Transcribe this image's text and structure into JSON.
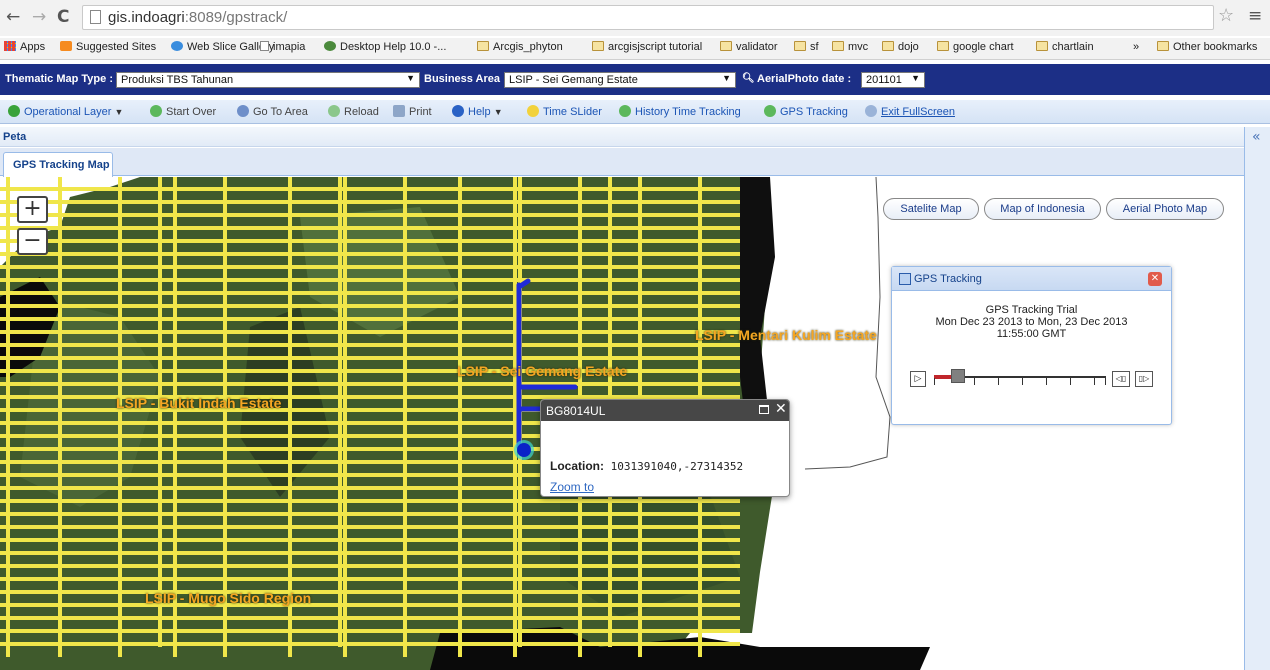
{
  "browser": {
    "url_host": "gis.indoagri",
    "url_rest": ":8089/gpstrack/",
    "bookmarks": [
      "Apps",
      "Suggested Sites",
      "Web Slice Gallery",
      "imapia",
      "Desktop Help 10.0 -...",
      "Arcgis_phyton",
      "arcgisjscript tutorial",
      "validator",
      "sf",
      "mvc",
      "dojo",
      "google chart",
      "chartlain",
      "»",
      "Other bookmarks"
    ]
  },
  "header": {
    "thematic_label": "Thematic Map Type :",
    "thematic_value": "Produksi TBS Tahunan",
    "business_label": "Business Area :",
    "business_value": "LSIP - Sei Gemang Estate",
    "aerial_label": "AerialPhoto date :",
    "aerial_value": "201101"
  },
  "toolbar": {
    "operational_layer": "Operational Layer",
    "start_over": "Start Over",
    "go_to_area": "Go To Area",
    "reload": "Reload",
    "print": "Print",
    "help": "Help",
    "time_slider": "Time SLider",
    "history_tracking": "History Time Tracking",
    "gps_tracking": "GPS Tracking",
    "exit_fullscreen": "Exit FullScreen"
  },
  "panel": {
    "title": "Peta",
    "collapse": "«",
    "tab": "GPS Tracking Map"
  },
  "map": {
    "zoom_in": "+",
    "zoom_out": "−",
    "basemap_buttons": [
      "Satelite Map",
      "Map of Indonesia",
      "Aerial Photo Map"
    ],
    "estate_labels": [
      "LSIP - Mentari Kulim Estate",
      "LSIP - Sei Gemang Estate",
      "LSIP - Bukit Indah Estate",
      "LSIP - Mugo Sido Region"
    ]
  },
  "gps_window": {
    "title": "GPS Tracking",
    "line1": "GPS Tracking Trial",
    "line2": "Mon Dec 23 2013  to  Mon, 23 Dec 2013",
    "line3": "11:55:00 GMT",
    "slider_position": 0.1
  },
  "popup": {
    "title": "BG8014UL",
    "location_label": "Location:",
    "location_value": "1031391040,-27314352",
    "zoom_link": "Zoom to"
  },
  "colors": {
    "header_bg": "#1c2f86",
    "road": "#f0e64a",
    "track": "#1f2bd6",
    "estate_label": "#f5a623"
  }
}
